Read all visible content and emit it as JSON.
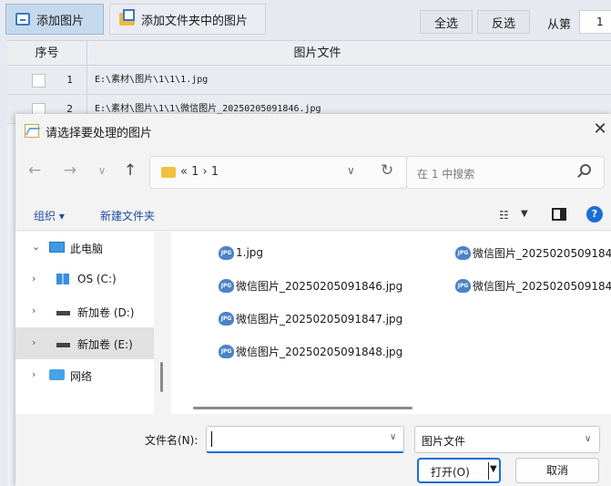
{
  "toolbar": {
    "add_images": "添加图片",
    "add_folder_images": "添加文件夹中的图片",
    "select_all": "全选",
    "invert_selection": "反选",
    "from_label": "从第",
    "from_value": "1"
  },
  "grid": {
    "col_no": "序号",
    "col_file": "图片文件",
    "rows": [
      {
        "no": "1",
        "path": "E:\\素材\\图片\\1\\1\\1.jpg"
      },
      {
        "no": "2",
        "path": "E:\\素材\\图片\\1\\1\\微信图片_20250205091846.jpg"
      }
    ]
  },
  "dialog": {
    "title": "请选择要处理的图片",
    "close": "✕",
    "breadcrumb": "« 1 › 1",
    "search_placeholder": "在 1 中搜索",
    "organize": "组织 ▾",
    "new_folder": "新建文件夹",
    "help": "?",
    "tree": [
      {
        "label": "此电脑",
        "arrow": "⌄",
        "icon": "computer-icon"
      },
      {
        "label": "OS (C:)",
        "arrow": "›",
        "icon": "windows-drive-icon"
      },
      {
        "label": "新加卷 (D:)",
        "arrow": "›",
        "icon": "drive-icon"
      },
      {
        "label": "新加卷 (E:)",
        "arrow": "›",
        "icon": "drive-icon",
        "selected": true
      },
      {
        "label": "网络",
        "arrow": "›",
        "icon": "network-icon"
      }
    ],
    "files": [
      "1.jpg",
      "微信图片_20250205091846.jpg",
      "微信图片_20250205091847.jpg",
      "微信图片_20250205091848.jpg",
      "微信图片_2025020509184",
      "微信图片_2025020509184"
    ],
    "jpg_icon_text": "JPG",
    "filename_label": "文件名(N):",
    "filename_value": "",
    "file_type": "图片文件",
    "open_button": "打开(O)",
    "cancel_button": "取消"
  }
}
